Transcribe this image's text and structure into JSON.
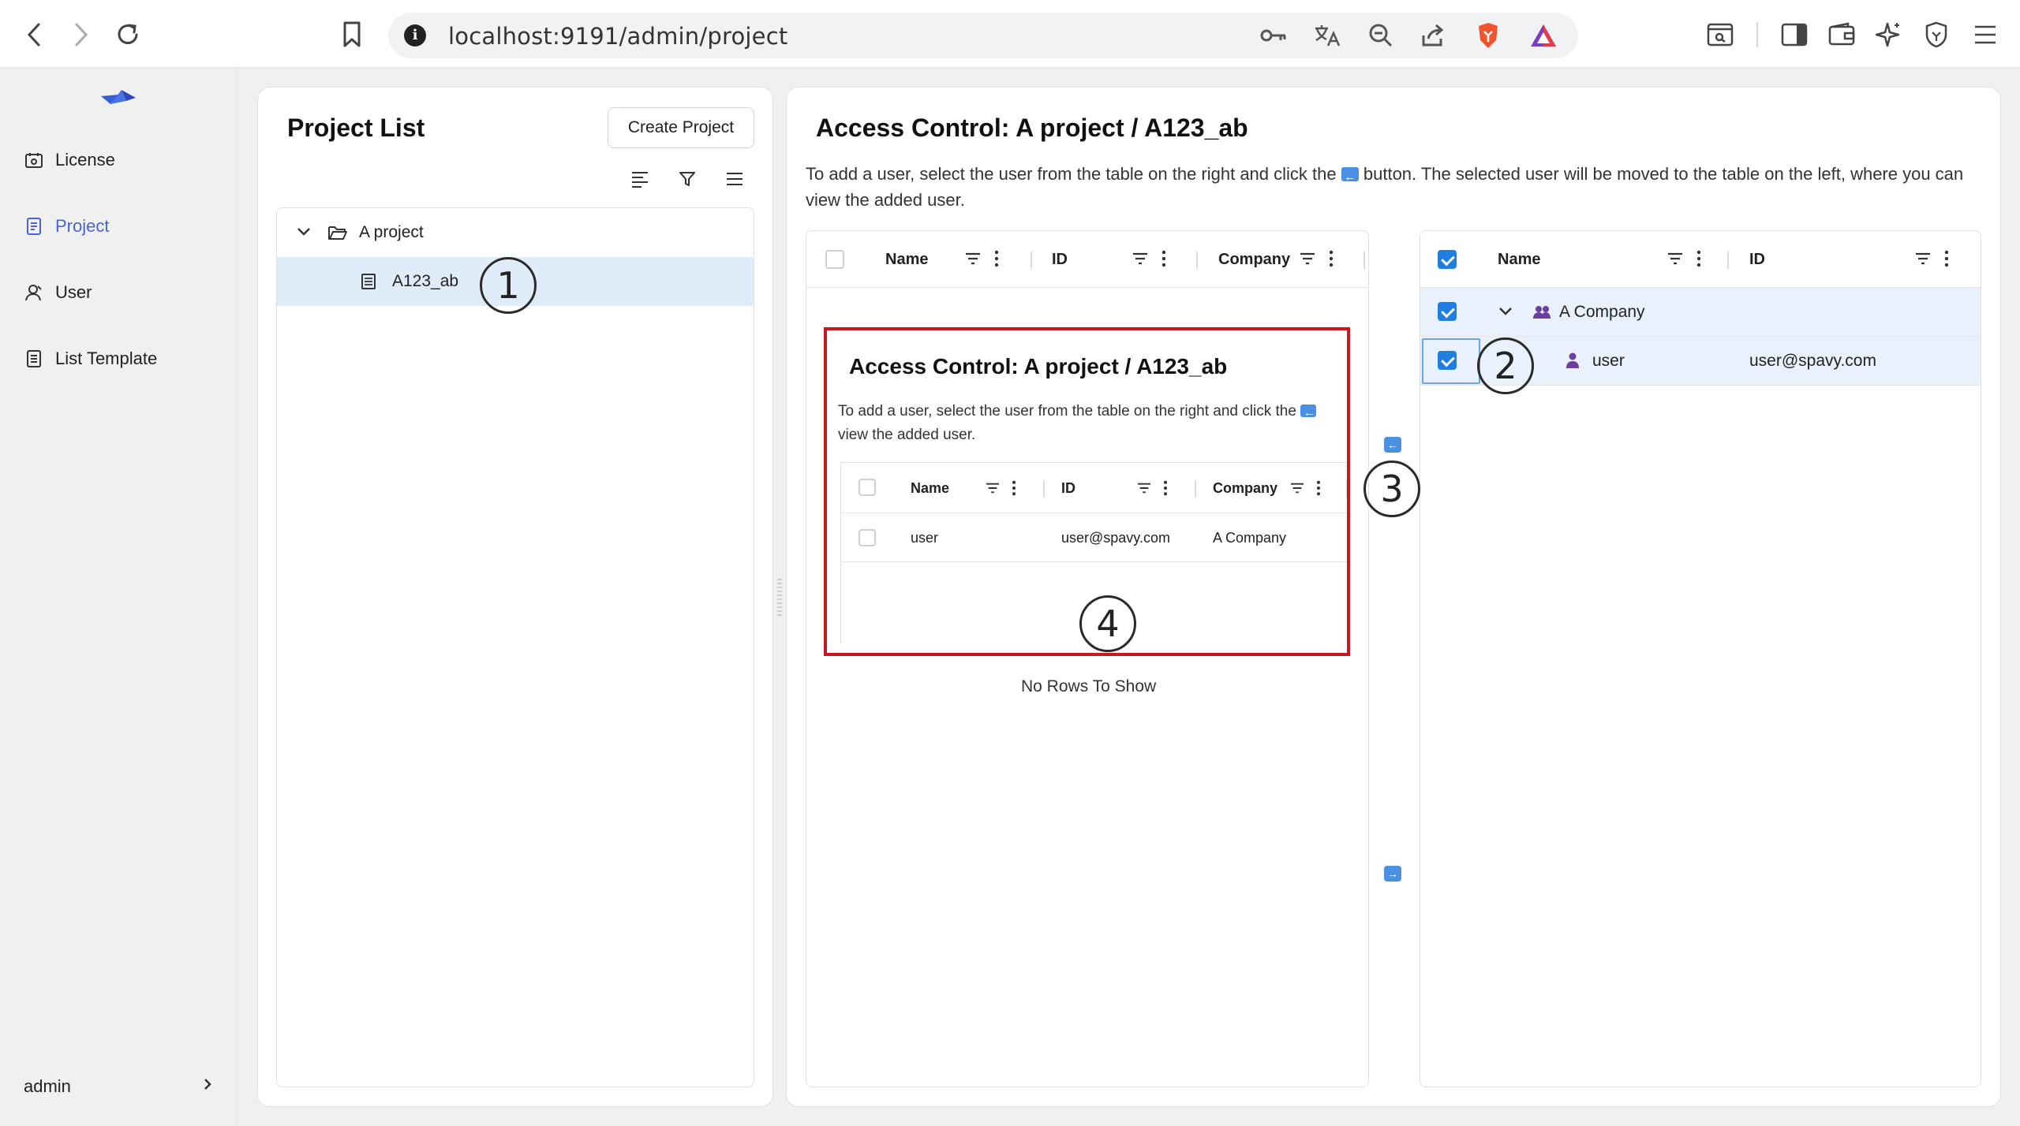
{
  "browser": {
    "url": "localhost:9191/admin/project"
  },
  "sidebar": {
    "items": [
      {
        "label": "License",
        "icon": "license-icon"
      },
      {
        "label": "Project",
        "icon": "project-icon",
        "active": true
      },
      {
        "label": "User",
        "icon": "user-icon"
      },
      {
        "label": "List Template",
        "icon": "list-template-icon"
      }
    ],
    "footer_user": "admin"
  },
  "project_list": {
    "title": "Project List",
    "create_button": "Create Project",
    "tree": [
      {
        "label": "A project",
        "type": "folder",
        "expanded": true
      },
      {
        "label": "A123_ab",
        "type": "file",
        "selected": true
      }
    ]
  },
  "access_control": {
    "title": "Access Control: A project / A123_ab",
    "description_part1": "To add a user, select the user from the table on the right and click the",
    "description_part2": "button. The selected user will be moved to the table on the left, where you can view the added user.",
    "left_grid": {
      "columns": [
        "Name",
        "ID",
        "Company"
      ],
      "empty_text": "No Rows To Show"
    },
    "right_grid": {
      "columns": [
        "Name",
        "ID"
      ],
      "group": {
        "label": "A Company",
        "checked": true
      },
      "rows": [
        {
          "name": "user",
          "id": "user@spavy.com",
          "checked": true
        }
      ]
    }
  },
  "annotation": {
    "title": "Access Control: A project / A123_ab",
    "desc_line1": "To add a user, select the user from the table on the right and click the",
    "desc_line2": "view the added user.",
    "columns": [
      "Name",
      "ID",
      "Company"
    ],
    "row": {
      "name": "user",
      "id": "user@spavy.com",
      "company": "A Company"
    },
    "markers": [
      "1",
      "2",
      "3",
      "4"
    ]
  },
  "colors": {
    "accent": "#4a63d6",
    "checkbox": "#1f7fe0",
    "selected_row": "#e0ecf9",
    "annotation_border": "#d0141c"
  }
}
